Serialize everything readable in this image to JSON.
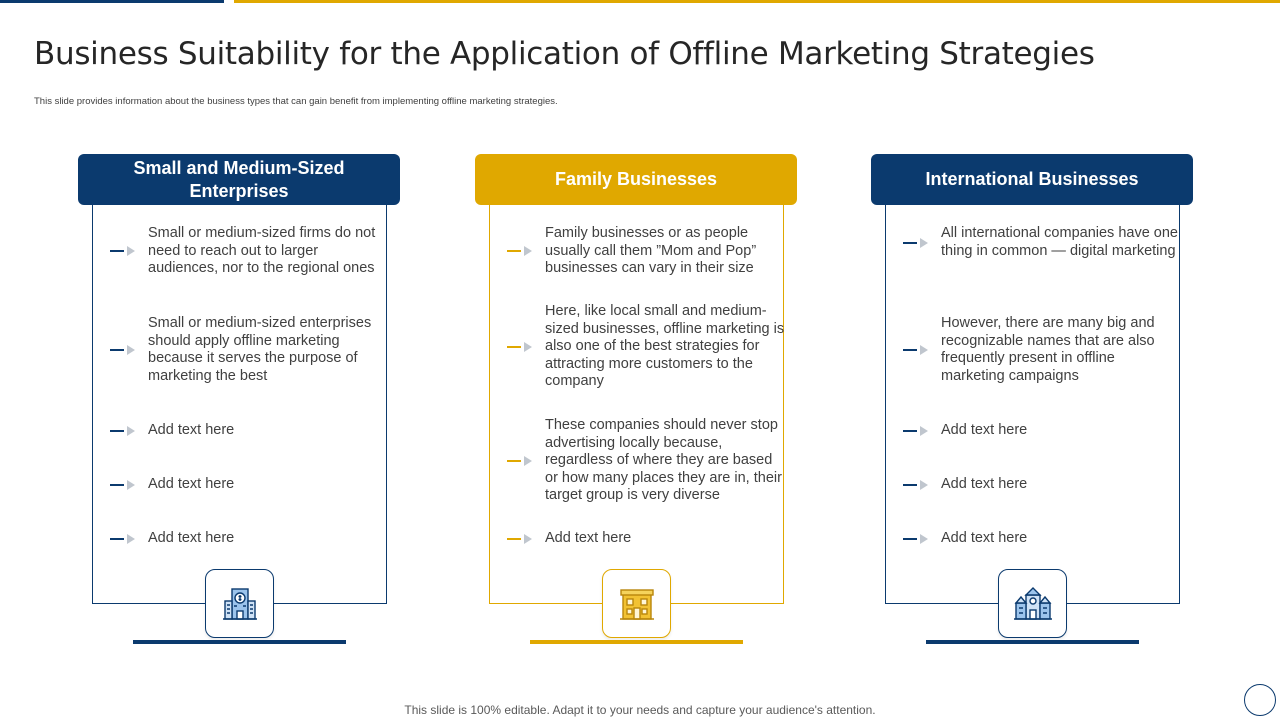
{
  "title": "Business Suitability for the Application of Offline Marketing Strategies",
  "subtitle": "This slide provides information about the business types that can gain benefit from implementing  offline marketing strategies.",
  "footer": "This slide is 100% editable. Adapt it to your needs and capture your audience's attention.",
  "colors": {
    "navy": "#0b3a6e",
    "gold": "#e0a800"
  },
  "columns": [
    {
      "title": "Small and Medium-Sized Enterprises",
      "icon": "bank-building-icon",
      "items": [
        "Small or medium-sized firms do not need to reach out to larger audiences, nor to the regional ones",
        "Small or medium-sized enterprises should apply offline marketing because it serves the purpose of marketing the best",
        "Add text here",
        "Add text here",
        "Add text here"
      ]
    },
    {
      "title": "Family Businesses",
      "icon": "storefront-icon",
      "items": [
        "Family businesses or as people usually call them ”Mom and Pop” businesses can vary in their size",
        "Here, like local small and medium-sized businesses, offline marketing is also one of the best strategies for attracting more customers to the company",
        "These companies should never stop advertising locally because, regardless of where they are based or how many places they are in, their target group is very diverse",
        "Add text here"
      ]
    },
    {
      "title": "International Businesses",
      "icon": "city-buildings-icon",
      "items": [
        "All international companies have one thing in common — digital marketing",
        "However, there are many big and recognizable names that are also frequently present in offline marketing campaigns",
        "Add text here",
        "Add text here",
        "Add text here"
      ]
    }
  ]
}
